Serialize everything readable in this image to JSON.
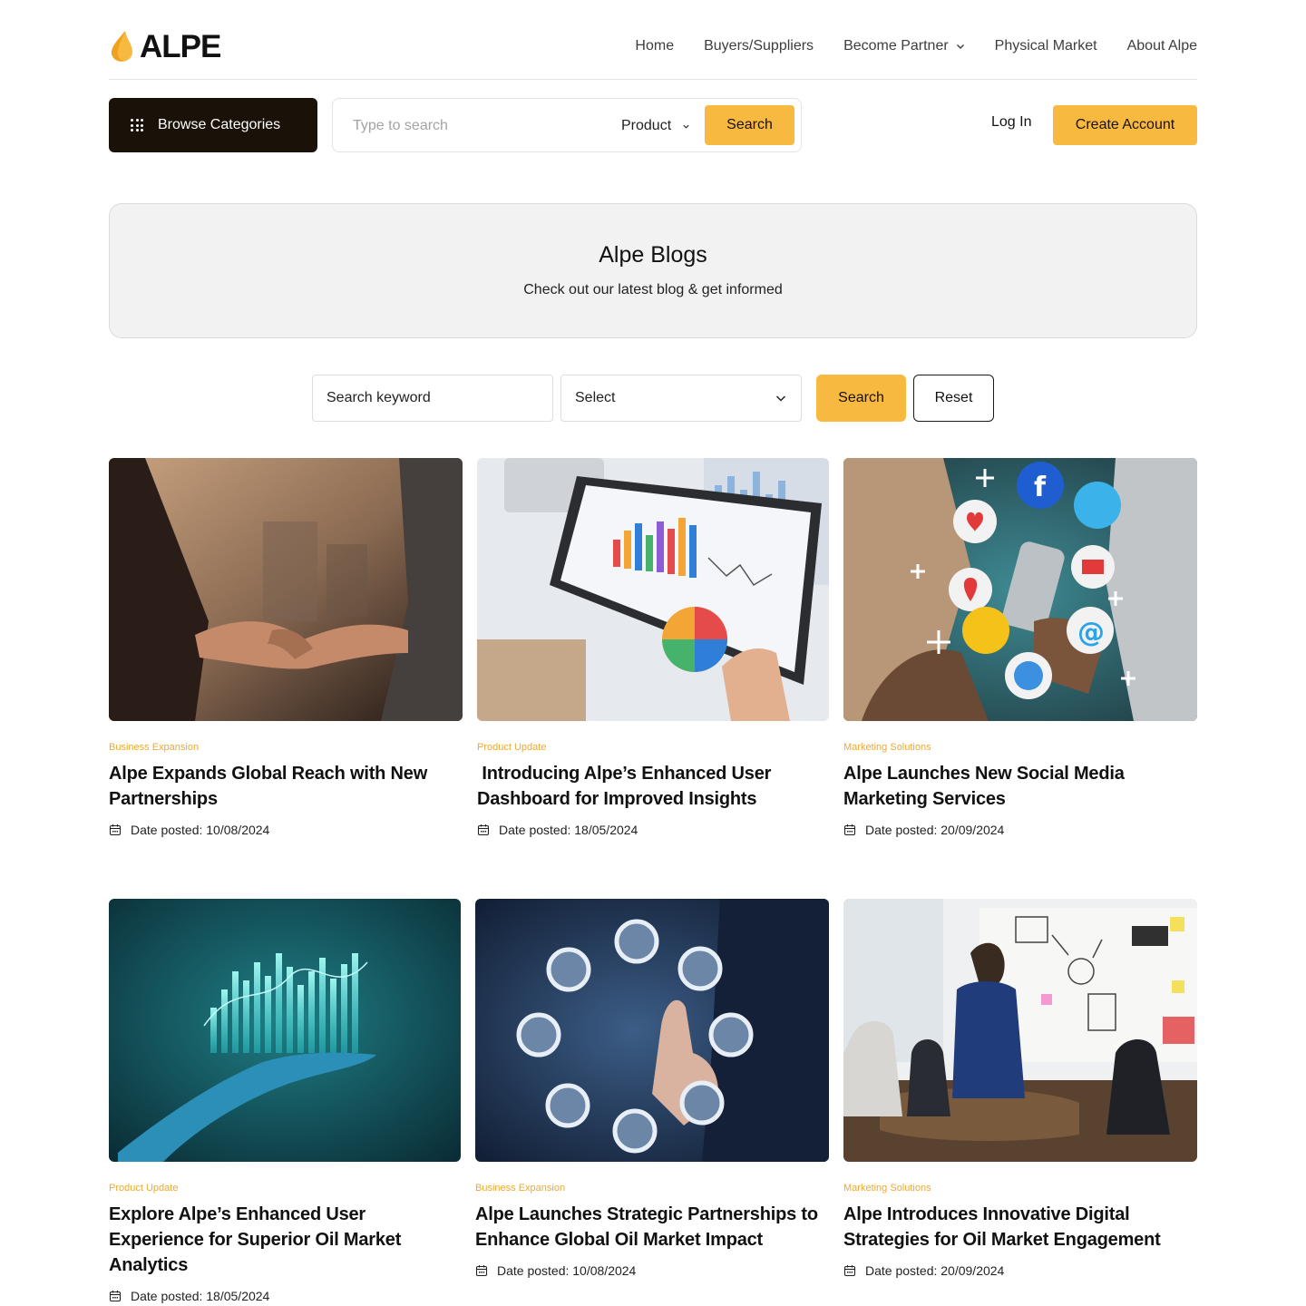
{
  "brand": {
    "name": "ALPE",
    "accent": "#f8b940",
    "dark": "#1a1109",
    "category_color": "#f0a82b"
  },
  "nav": {
    "items": [
      {
        "label": "Home"
      },
      {
        "label": "Buyers/Suppliers"
      },
      {
        "label": "Become Partner",
        "has_dropdown": true
      },
      {
        "label": "Physical Market"
      },
      {
        "label": "About Alpe"
      }
    ]
  },
  "toolbar": {
    "browse_label": "Browse Categories",
    "search_placeholder": "Type to search",
    "search_scope": "Product",
    "search_label": "Search",
    "login_label": "Log In",
    "create_account_label": "Create Account"
  },
  "hero": {
    "title": "Alpe Blogs",
    "subtitle": "Check out our latest blog & get informed"
  },
  "filter": {
    "keyword_placeholder": "Search keyword",
    "select_value": "Select",
    "search_label": "Search",
    "reset_label": "Reset"
  },
  "posts": [
    {
      "category": "Business Expansion",
      "title": "Alpe Expands Global Reach with New Partnerships",
      "date": "Date posted: 10/08/2024",
      "image": "handshake-photo"
    },
    {
      "category": "Product Update",
      "title": " Introducing Alpe’s Enhanced User Dashboard for Improved Insights",
      "date": "Date posted: 18/05/2024",
      "image": "tablet-analytics-photo"
    },
    {
      "category": "Marketing Solutions",
      "title": "Alpe Launches New Social Media Marketing Services",
      "date": "Date posted: 20/09/2024",
      "image": "social-media-icons-photo"
    },
    {
      "category": "Product Update",
      "title": "Explore Alpe’s Enhanced User Experience for Superior Oil Market Analytics",
      "date": "Date posted: 18/05/2024",
      "image": "hologram-chart-photo"
    },
    {
      "category": "Business Expansion",
      "title": "Alpe Launches Strategic Partnerships to Enhance Global Oil Market Impact",
      "date": "Date posted: 10/08/2024",
      "image": "touch-circles-photo"
    },
    {
      "category": "Marketing Solutions",
      "title": "Alpe Introduces Innovative Digital Strategies for Oil Market Engagement",
      "date": "Date posted: 20/09/2024",
      "image": "meeting-whiteboard-photo"
    }
  ]
}
